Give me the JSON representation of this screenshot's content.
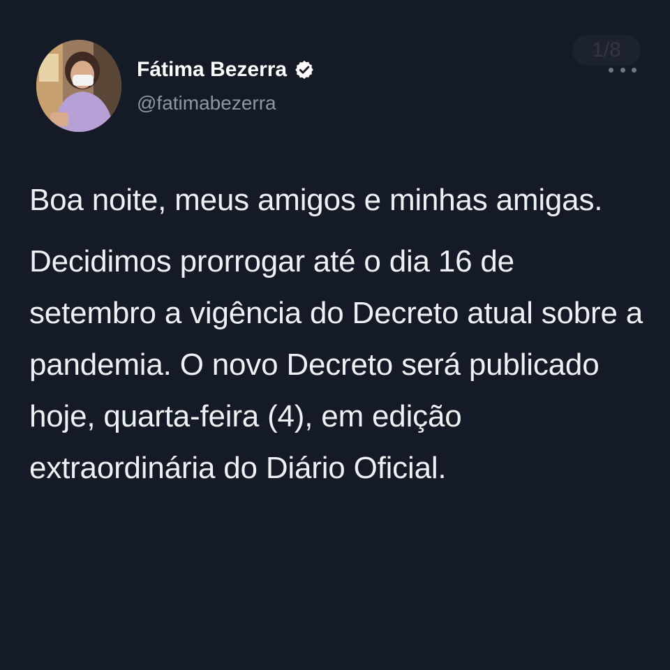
{
  "header": {
    "display_name": "Fátima Bezerra",
    "handle": "@fatimabezerra",
    "verified_icon": "verified-badge-icon",
    "more_icon": "more-options-icon",
    "page_indicator": "1/8"
  },
  "tweet": {
    "paragraphs": [
      "Boa noite, meus amigos e minhas amigas.",
      "Decidimos prorrogar até o dia 16 de setembro a vigência do Decreto atual sobre a pandemia. O novo Decreto será publicado hoje, quarta-feira (4), em edição extraordinária do Diário Oficial."
    ]
  },
  "colors": {
    "background": "#151b26",
    "text": "#eef1f4",
    "handle": "#8b97a6"
  }
}
